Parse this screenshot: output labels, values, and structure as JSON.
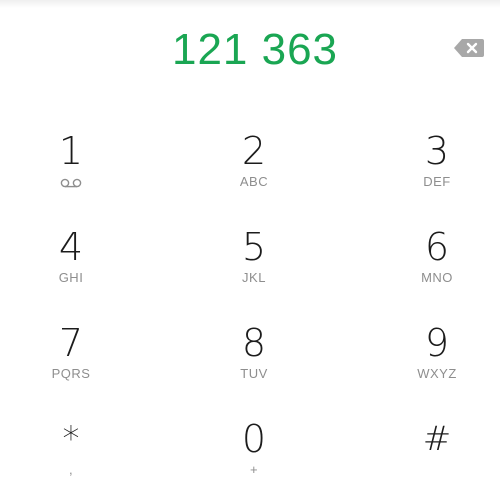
{
  "display": {
    "number": "121 363"
  },
  "icons": {
    "backspace": "backspace-icon",
    "voicemail": "voicemail-icon",
    "backspace_color": "#9e9e9e"
  },
  "colors": {
    "number_accent": "#1aa653"
  },
  "keys": [
    {
      "digit": "1",
      "sub": ""
    },
    {
      "digit": "2",
      "sub": "ABC"
    },
    {
      "digit": "3",
      "sub": "DEF"
    },
    {
      "digit": "4",
      "sub": "GHI"
    },
    {
      "digit": "5",
      "sub": "JKL"
    },
    {
      "digit": "6",
      "sub": "MNO"
    },
    {
      "digit": "7",
      "sub": "PQRS"
    },
    {
      "digit": "8",
      "sub": "TUV"
    },
    {
      "digit": "9",
      "sub": "WXYZ"
    },
    {
      "digit": "*",
      "sub": ","
    },
    {
      "digit": "0",
      "sub": "+"
    },
    {
      "digit": "#",
      "sub": ""
    }
  ]
}
